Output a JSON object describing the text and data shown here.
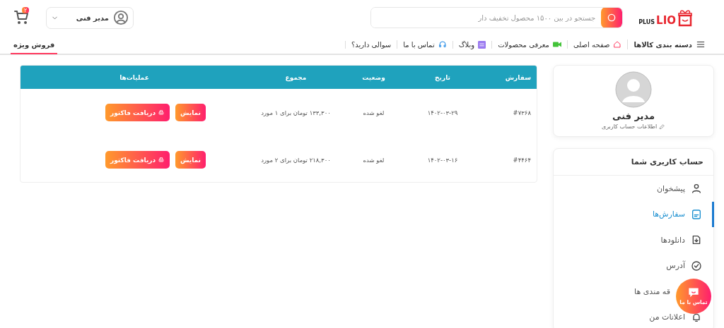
{
  "logo": {
    "main": "LIO",
    "sub": "PLUS"
  },
  "search": {
    "placeholder": "جستجو در بین ۱۵۰۰ محصول تخفیف دار"
  },
  "user_menu": {
    "name": "مدیر فنی"
  },
  "cart": {
    "count": "۲"
  },
  "nav": [
    {
      "kind": "menu",
      "label": "دسته بندی کالاها"
    },
    {
      "kind": "home",
      "label": "صفحه اصلی"
    },
    {
      "kind": "video",
      "label": "معرفی محصولات"
    },
    {
      "kind": "blog",
      "label": "وبلاگ"
    },
    {
      "kind": "headset",
      "label": "تماس با ما"
    },
    {
      "kind": "plain",
      "label": "سوالی دارید؟"
    }
  ],
  "special_sale": {
    "label": "فروش ویژه"
  },
  "profile": {
    "name": "مدیر فنی",
    "edit_link": "اطلاعات حساب کاربری"
  },
  "account_menu": {
    "title": "حساب کاربری شما",
    "items": [
      {
        "kind": "user",
        "label": "پیشخوان",
        "selected": false
      },
      {
        "kind": "orders",
        "label": "سفارش‌ها",
        "selected": true
      },
      {
        "kind": "download",
        "label": "دانلودها",
        "selected": false
      },
      {
        "kind": "address",
        "label": "آدرس",
        "selected": false
      },
      {
        "kind": "covered",
        "label": "قه مندی ها",
        "selected": false
      },
      {
        "kind": "bell",
        "label": "اعلانات من",
        "selected": false
      }
    ]
  },
  "orders_table": {
    "columns": [
      "سفارش",
      "تاریخ",
      "وضعیت",
      "مجموع",
      "عملیات‌ها"
    ],
    "rows": [
      {
        "order": "#۷۳۶۸",
        "date": "۱۴۰۲-۰۳-۲۹",
        "status": "لغو شده",
        "total": "۱۳۳,۳۰۰ تومان برای ۱ مورد",
        "view": "نمایش",
        "invoice": "دریافت فاکتور"
      },
      {
        "order": "#۴۴۶۴",
        "date": "۱۴۰۲-۰۳-۱۶",
        "status": "لغو شده",
        "total": "۲۱۸,۳۰۰ تومان برای ۲ مورد",
        "view": "نمایش",
        "invoice": "دریافت فاکتور"
      }
    ]
  },
  "chat_button": {
    "label": "تماس با ما"
  }
}
